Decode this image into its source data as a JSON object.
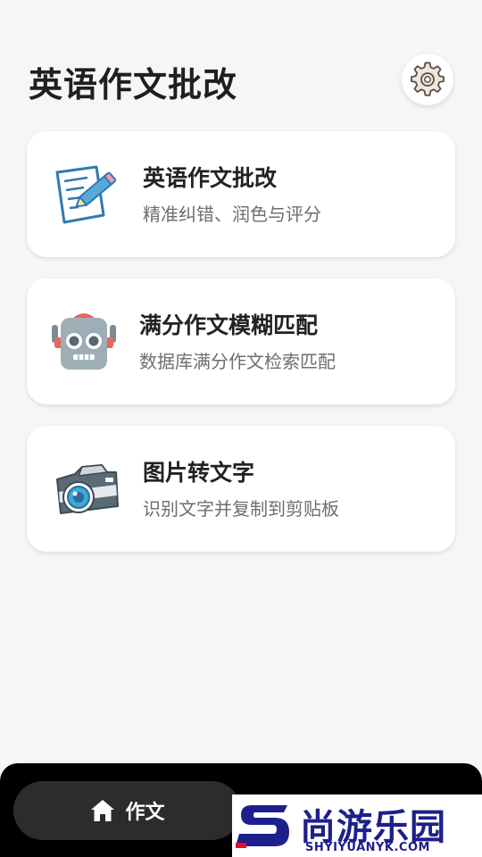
{
  "header": {
    "title": "英语作文批改",
    "settings_icon": "gear-icon"
  },
  "cards": [
    {
      "title": "英语作文批改",
      "subtitle": "精准纠错、润色与评分",
      "icon": "note-pencil-icon"
    },
    {
      "title": "满分作文模糊匹配",
      "subtitle": "数据库满分作文检索匹配",
      "icon": "robot-icon"
    },
    {
      "title": "图片转文字",
      "subtitle": "识别文字并复制到剪贴板",
      "icon": "camera-icon"
    }
  ],
  "bottom_nav": {
    "home_label": "作文",
    "home_icon": "home-icon"
  },
  "watermark": {
    "brand": "尚游乐园",
    "url": "SHYIYUANYK.COM"
  },
  "colors": {
    "background": "#f5f6f8",
    "card": "#ffffff",
    "nav_bar": "#000000",
    "nav_pill": "#2c2c2c",
    "watermark_blue": "#1d1f8c",
    "watermark_red": "#e0102a"
  }
}
